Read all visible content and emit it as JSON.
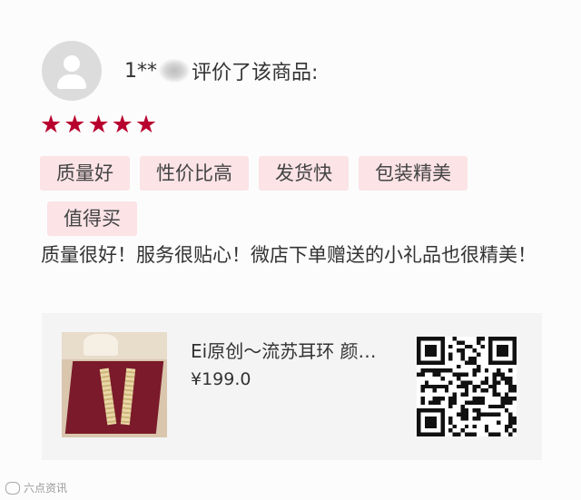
{
  "review": {
    "user_prefix": "1**",
    "action_text": "评价了该商品:",
    "rating": 5,
    "star_glyph": "★",
    "star_color": "#b8002e",
    "tags": [
      "质量好",
      "性价比高",
      "发货快",
      "包装精美",
      "值得买"
    ],
    "tag_bg_color": "#fbe3e6",
    "comment": "质量很好！服务很贴心！微店下单赠送的小礼品也很精美！"
  },
  "product": {
    "title": "Ei原创～流苏耳环 颜…",
    "price": "¥199.0",
    "image_icon": "tassel-earrings-photo",
    "qr_icon": "qr-code"
  },
  "watermark": {
    "text": "六点资讯"
  }
}
